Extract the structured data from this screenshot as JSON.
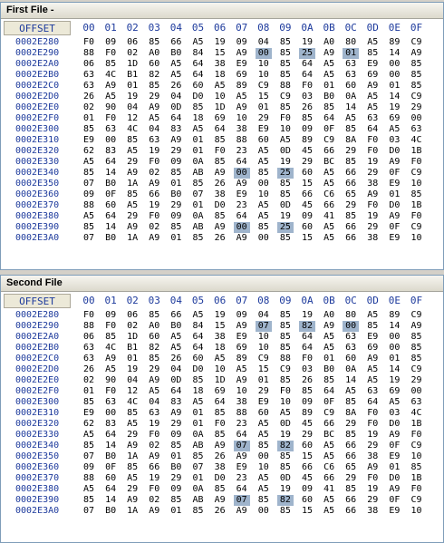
{
  "offset_header": "OFFSET",
  "byte_headers": [
    "00",
    "01",
    "02",
    "03",
    "04",
    "05",
    "06",
    "07",
    "08",
    "09",
    "0A",
    "0B",
    "0C",
    "0D",
    "0E",
    "0F"
  ],
  "colors": {
    "highlight": "#9fb4cc",
    "offset_text": "#1d3a9c"
  },
  "panes": [
    {
      "title": "First File -",
      "rows": [
        {
          "offset": "0002E280",
          "bytes": [
            "F0",
            "09",
            "06",
            "85",
            "66",
            "A5",
            "19",
            "09",
            "04",
            "85",
            "19",
            "A0",
            "80",
            "A5",
            "89",
            "C9"
          ],
          "hl": []
        },
        {
          "offset": "0002E290",
          "bytes": [
            "88",
            "F0",
            "02",
            "A0",
            "B0",
            "84",
            "15",
            "A9",
            "00",
            "85",
            "25",
            "A9",
            "01",
            "85",
            "14",
            "A9"
          ],
          "hl": [
            8,
            10,
            12
          ]
        },
        {
          "offset": "0002E2A0",
          "bytes": [
            "06",
            "85",
            "1D",
            "60",
            "A5",
            "64",
            "38",
            "E9",
            "10",
            "85",
            "64",
            "A5",
            "63",
            "E9",
            "00",
            "85"
          ],
          "hl": []
        },
        {
          "offset": "0002E2B0",
          "bytes": [
            "63",
            "4C",
            "B1",
            "82",
            "A5",
            "64",
            "18",
            "69",
            "10",
            "85",
            "64",
            "A5",
            "63",
            "69",
            "00",
            "85"
          ],
          "hl": []
        },
        {
          "offset": "0002E2C0",
          "bytes": [
            "63",
            "A9",
            "01",
            "85",
            "26",
            "60",
            "A5",
            "89",
            "C9",
            "88",
            "F0",
            "01",
            "60",
            "A9",
            "01",
            "85"
          ],
          "hl": []
        },
        {
          "offset": "0002E2D0",
          "bytes": [
            "26",
            "A5",
            "19",
            "29",
            "04",
            "D0",
            "10",
            "A5",
            "15",
            "C9",
            "03",
            "B0",
            "0A",
            "A5",
            "14",
            "C9"
          ],
          "hl": []
        },
        {
          "offset": "0002E2E0",
          "bytes": [
            "02",
            "90",
            "04",
            "A9",
            "0D",
            "85",
            "1D",
            "A9",
            "01",
            "85",
            "26",
            "85",
            "14",
            "A5",
            "19",
            "29"
          ],
          "hl": []
        },
        {
          "offset": "0002E2F0",
          "bytes": [
            "01",
            "F0",
            "12",
            "A5",
            "64",
            "18",
            "69",
            "10",
            "29",
            "F0",
            "85",
            "64",
            "A5",
            "63",
            "69",
            "00"
          ],
          "hl": []
        },
        {
          "offset": "0002E300",
          "bytes": [
            "85",
            "63",
            "4C",
            "04",
            "83",
            "A5",
            "64",
            "38",
            "E9",
            "10",
            "09",
            "0F",
            "85",
            "64",
            "A5",
            "63"
          ],
          "hl": []
        },
        {
          "offset": "0002E310",
          "bytes": [
            "E9",
            "00",
            "85",
            "63",
            "A9",
            "01",
            "85",
            "88",
            "60",
            "A5",
            "89",
            "C9",
            "8A",
            "F0",
            "03",
            "4C"
          ],
          "hl": []
        },
        {
          "offset": "0002E320",
          "bytes": [
            "62",
            "83",
            "A5",
            "19",
            "29",
            "01",
            "F0",
            "23",
            "A5",
            "0D",
            "45",
            "66",
            "29",
            "F0",
            "D0",
            "1B"
          ],
          "hl": []
        },
        {
          "offset": "0002E330",
          "bytes": [
            "A5",
            "64",
            "29",
            "F0",
            "09",
            "0A",
            "85",
            "64",
            "A5",
            "19",
            "29",
            "BC",
            "85",
            "19",
            "A9",
            "F0"
          ],
          "hl": []
        },
        {
          "offset": "0002E340",
          "bytes": [
            "85",
            "14",
            "A9",
            "02",
            "85",
            "AB",
            "A9",
            "00",
            "85",
            "25",
            "60",
            "A5",
            "66",
            "29",
            "0F",
            "C9"
          ],
          "hl": [
            7,
            9
          ]
        },
        {
          "offset": "0002E350",
          "bytes": [
            "07",
            "B0",
            "1A",
            "A9",
            "01",
            "85",
            "26",
            "A9",
            "00",
            "85",
            "15",
            "A5",
            "66",
            "38",
            "E9",
            "10"
          ],
          "hl": []
        },
        {
          "offset": "0002E360",
          "bytes": [
            "09",
            "0F",
            "85",
            "66",
            "B0",
            "07",
            "38",
            "E9",
            "10",
            "85",
            "66",
            "C6",
            "65",
            "A9",
            "01",
            "85"
          ],
          "hl": []
        },
        {
          "offset": "0002E370",
          "bytes": [
            "88",
            "60",
            "A5",
            "19",
            "29",
            "01",
            "D0",
            "23",
            "A5",
            "0D",
            "45",
            "66",
            "29",
            "F0",
            "D0",
            "1B"
          ],
          "hl": []
        },
        {
          "offset": "0002E380",
          "bytes": [
            "A5",
            "64",
            "29",
            "F0",
            "09",
            "0A",
            "85",
            "64",
            "A5",
            "19",
            "09",
            "41",
            "85",
            "19",
            "A9",
            "F0"
          ],
          "hl": []
        },
        {
          "offset": "0002E390",
          "bytes": [
            "85",
            "14",
            "A9",
            "02",
            "85",
            "AB",
            "A9",
            "00",
            "85",
            "25",
            "60",
            "A5",
            "66",
            "29",
            "0F",
            "C9"
          ],
          "hl": [
            7,
            9
          ]
        },
        {
          "offset": "0002E3A0",
          "bytes": [
            "07",
            "B0",
            "1A",
            "A9",
            "01",
            "85",
            "26",
            "A9",
            "00",
            "85",
            "15",
            "A5",
            "66",
            "38",
            "E9",
            "10"
          ],
          "hl": []
        }
      ]
    },
    {
      "title": "Second File",
      "rows": [
        {
          "offset": "0002E280",
          "bytes": [
            "F0",
            "09",
            "06",
            "85",
            "66",
            "A5",
            "19",
            "09",
            "04",
            "85",
            "19",
            "A0",
            "80",
            "A5",
            "89",
            "C9"
          ],
          "hl": []
        },
        {
          "offset": "0002E290",
          "bytes": [
            "88",
            "F0",
            "02",
            "A0",
            "B0",
            "84",
            "15",
            "A9",
            "07",
            "85",
            "82",
            "A9",
            "00",
            "85",
            "14",
            "A9"
          ],
          "hl": [
            8,
            10,
            12
          ]
        },
        {
          "offset": "0002E2A0",
          "bytes": [
            "06",
            "85",
            "1D",
            "60",
            "A5",
            "64",
            "38",
            "E9",
            "10",
            "85",
            "64",
            "A5",
            "63",
            "E9",
            "00",
            "85"
          ],
          "hl": []
        },
        {
          "offset": "0002E2B0",
          "bytes": [
            "63",
            "4C",
            "B1",
            "82",
            "A5",
            "64",
            "18",
            "69",
            "10",
            "85",
            "64",
            "A5",
            "63",
            "69",
            "00",
            "85"
          ],
          "hl": []
        },
        {
          "offset": "0002E2C0",
          "bytes": [
            "63",
            "A9",
            "01",
            "85",
            "26",
            "60",
            "A5",
            "89",
            "C9",
            "88",
            "F0",
            "01",
            "60",
            "A9",
            "01",
            "85"
          ],
          "hl": []
        },
        {
          "offset": "0002E2D0",
          "bytes": [
            "26",
            "A5",
            "19",
            "29",
            "04",
            "D0",
            "10",
            "A5",
            "15",
            "C9",
            "03",
            "B0",
            "0A",
            "A5",
            "14",
            "C9"
          ],
          "hl": []
        },
        {
          "offset": "0002E2E0",
          "bytes": [
            "02",
            "90",
            "04",
            "A9",
            "0D",
            "85",
            "1D",
            "A9",
            "01",
            "85",
            "26",
            "85",
            "14",
            "A5",
            "19",
            "29"
          ],
          "hl": []
        },
        {
          "offset": "0002E2F0",
          "bytes": [
            "01",
            "F0",
            "12",
            "A5",
            "64",
            "18",
            "69",
            "10",
            "29",
            "F0",
            "85",
            "64",
            "A5",
            "63",
            "69",
            "00"
          ],
          "hl": []
        },
        {
          "offset": "0002E300",
          "bytes": [
            "85",
            "63",
            "4C",
            "04",
            "83",
            "A5",
            "64",
            "38",
            "E9",
            "10",
            "09",
            "0F",
            "85",
            "64",
            "A5",
            "63"
          ],
          "hl": []
        },
        {
          "offset": "0002E310",
          "bytes": [
            "E9",
            "00",
            "85",
            "63",
            "A9",
            "01",
            "85",
            "88",
            "60",
            "A5",
            "89",
            "C9",
            "8A",
            "F0",
            "03",
            "4C"
          ],
          "hl": []
        },
        {
          "offset": "0002E320",
          "bytes": [
            "62",
            "83",
            "A5",
            "19",
            "29",
            "01",
            "F0",
            "23",
            "A5",
            "0D",
            "45",
            "66",
            "29",
            "F0",
            "D0",
            "1B"
          ],
          "hl": []
        },
        {
          "offset": "0002E330",
          "bytes": [
            "A5",
            "64",
            "29",
            "F0",
            "09",
            "0A",
            "85",
            "64",
            "A5",
            "19",
            "29",
            "BC",
            "85",
            "19",
            "A9",
            "F0"
          ],
          "hl": []
        },
        {
          "offset": "0002E340",
          "bytes": [
            "85",
            "14",
            "A9",
            "02",
            "85",
            "AB",
            "A9",
            "07",
            "85",
            "82",
            "60",
            "A5",
            "66",
            "29",
            "0F",
            "C9"
          ],
          "hl": [
            7,
            9
          ]
        },
        {
          "offset": "0002E350",
          "bytes": [
            "07",
            "B0",
            "1A",
            "A9",
            "01",
            "85",
            "26",
            "A9",
            "00",
            "85",
            "15",
            "A5",
            "66",
            "38",
            "E9",
            "10"
          ],
          "hl": []
        },
        {
          "offset": "0002E360",
          "bytes": [
            "09",
            "0F",
            "85",
            "66",
            "B0",
            "07",
            "38",
            "E9",
            "10",
            "85",
            "66",
            "C6",
            "65",
            "A9",
            "01",
            "85"
          ],
          "hl": []
        },
        {
          "offset": "0002E370",
          "bytes": [
            "88",
            "60",
            "A5",
            "19",
            "29",
            "01",
            "D0",
            "23",
            "A5",
            "0D",
            "45",
            "66",
            "29",
            "F0",
            "D0",
            "1B"
          ],
          "hl": []
        },
        {
          "offset": "0002E380",
          "bytes": [
            "A5",
            "64",
            "29",
            "F0",
            "09",
            "0A",
            "85",
            "64",
            "A5",
            "19",
            "09",
            "41",
            "85",
            "19",
            "A9",
            "F0"
          ],
          "hl": []
        },
        {
          "offset": "0002E390",
          "bytes": [
            "85",
            "14",
            "A9",
            "02",
            "85",
            "AB",
            "A9",
            "07",
            "85",
            "82",
            "60",
            "A5",
            "66",
            "29",
            "0F",
            "C9"
          ],
          "hl": [
            7,
            9
          ]
        },
        {
          "offset": "0002E3A0",
          "bytes": [
            "07",
            "B0",
            "1A",
            "A9",
            "01",
            "85",
            "26",
            "A9",
            "00",
            "85",
            "15",
            "A5",
            "66",
            "38",
            "E9",
            "10"
          ],
          "hl": []
        }
      ]
    }
  ]
}
